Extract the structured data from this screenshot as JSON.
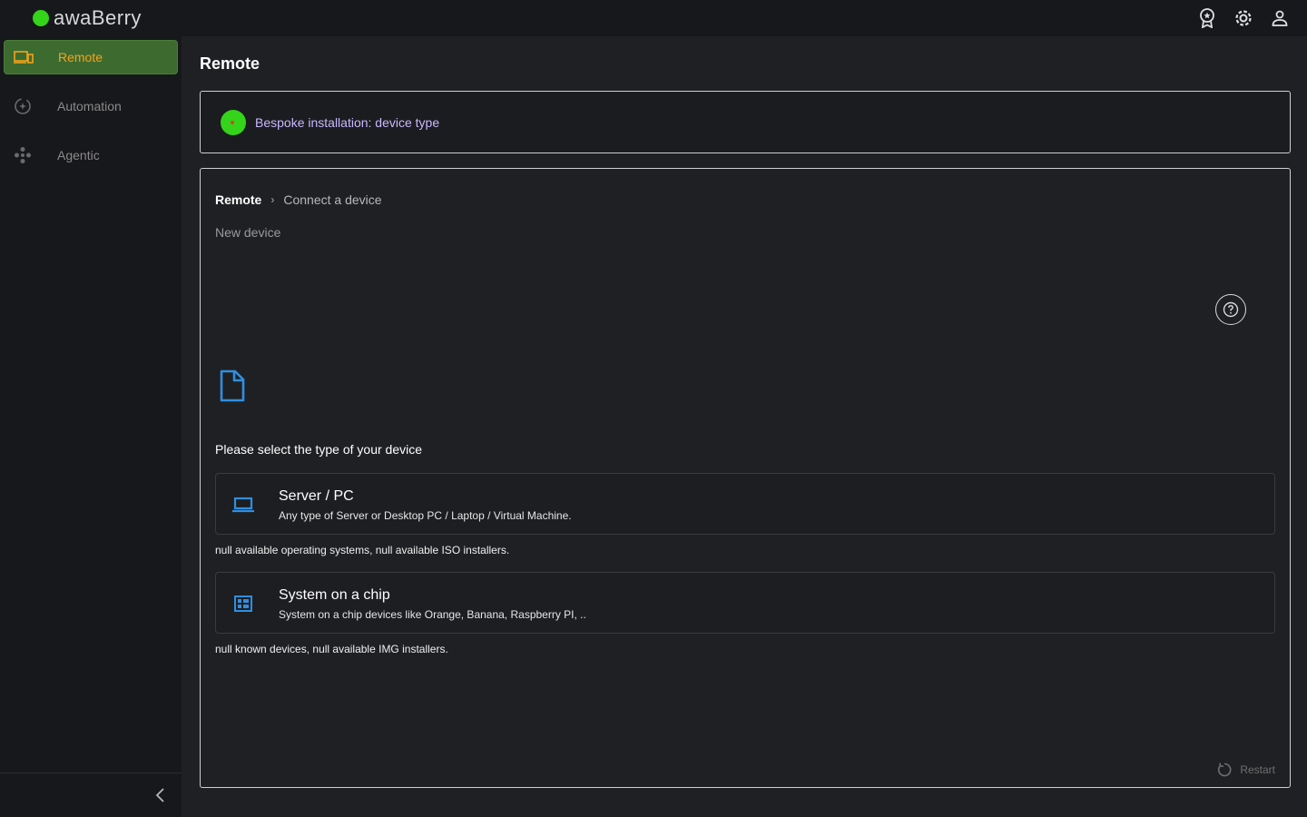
{
  "app": {
    "name": "awaBerry",
    "brand_color": "#33d41a",
    "accent_color": "#f4a31a"
  },
  "sidebar": {
    "items": [
      {
        "label": "Remote",
        "icon": "devices-icon",
        "active": true
      },
      {
        "label": "Automation",
        "icon": "automation-icon",
        "active": false
      },
      {
        "label": "Agentic",
        "icon": "agentic-icon",
        "active": false
      }
    ],
    "collapse_icon": "chevron-left-icon"
  },
  "topbar": {
    "icons": [
      "badge-icon",
      "gear-icon",
      "user-icon"
    ]
  },
  "main": {
    "title": "Remote",
    "status": {
      "text": "Bespoke installation: device type",
      "indicator_color": "#33d41a"
    },
    "breadcrumb": {
      "root": "Remote",
      "current": "Connect a device"
    },
    "subtitle": "New device",
    "prompt": "Please select the type of your device",
    "options": [
      {
        "title": "Server / PC",
        "description": "Any type of Server or Desktop PC / Laptop / Virtual Machine.",
        "note": "null available operating systems, null available ISO installers.",
        "icon": "laptop-icon"
      },
      {
        "title": "System on a chip",
        "description": "System on a chip devices like Orange, Banana, Raspberry PI, ..",
        "note": "null known devices, null available IMG installers.",
        "icon": "chip-icon"
      }
    ],
    "restart_label": "Restart"
  }
}
